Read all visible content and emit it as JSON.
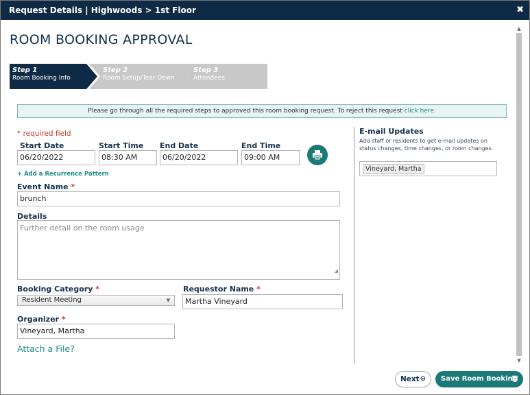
{
  "window": {
    "title": "Request Details | Highwoods > 1st Floor",
    "close_glyph": "✖"
  },
  "page_title": "ROOM BOOKING APPROVAL",
  "steps": [
    {
      "num": "Step 1",
      "label": "Room Booking Info",
      "active": true
    },
    {
      "num": "Step 2",
      "label": "Room Setup/Tear Down",
      "active": false
    },
    {
      "num": "Step 3",
      "label": "Attendees",
      "active": false
    }
  ],
  "banner": {
    "text": "Please go through all the required steps to approved this room booking request. To reject this request ",
    "link": "click here."
  },
  "required_note": "* required field",
  "form": {
    "start_date": {
      "label": "Start Date",
      "value": "06/20/2022"
    },
    "start_time": {
      "label": "Start Time",
      "value": "08:30 AM"
    },
    "end_date": {
      "label": "End Date",
      "value": "06/20/2022"
    },
    "end_time": {
      "label": "End Time",
      "value": "09:00 AM"
    },
    "recurrence_link": "+ Add a Recurrence Pattern",
    "event_name": {
      "label": "Event Name",
      "required": "*",
      "value": "brunch"
    },
    "details": {
      "label": "Details",
      "placeholder": "Further detail on the room usage"
    },
    "booking_category": {
      "label": "Booking Category",
      "required": "*",
      "value": "Resident Meeting"
    },
    "requestor_name": {
      "label": "Requestor Name",
      "required": "*",
      "value": "Martha Vineyard"
    },
    "organizer": {
      "label": "Organizer",
      "required": "*",
      "value": "Vineyard, Martha"
    },
    "attach_link": "Attach a File?"
  },
  "email_updates": {
    "title": "E-mail Updates",
    "description": "Add staff or residents to get e-mail updates on status changes, time changes, or room changes.",
    "recipients": [
      "Vineyard, Martha"
    ]
  },
  "buttons": {
    "next": "Next",
    "save": "Save Room Booking"
  },
  "icons": {
    "print": "print-icon",
    "next": "arrow-circle-right-icon",
    "save": "save-icon",
    "close": "close-icon"
  },
  "colors": {
    "navy": "#0f2a44",
    "teal": "#1b7a78",
    "required": "#c0392b"
  }
}
